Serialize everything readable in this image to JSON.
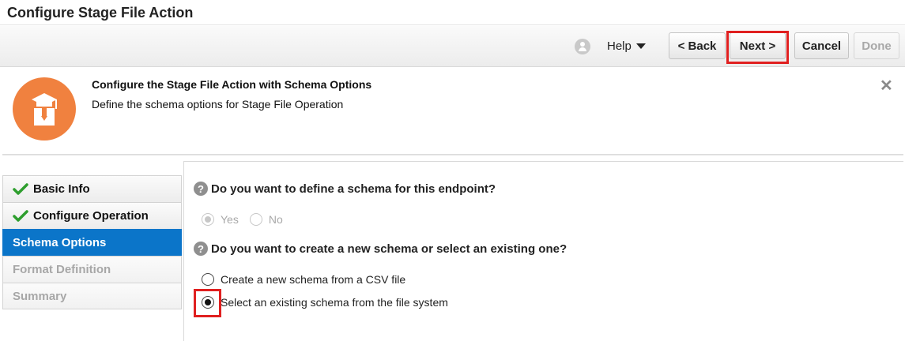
{
  "window": {
    "title": "Configure Stage File Action"
  },
  "toolbar": {
    "help_label": "Help",
    "back_label": "< Back",
    "next_label": "Next >",
    "cancel_label": "Cancel",
    "done_label": "Done"
  },
  "info": {
    "title": "Configure the Stage File Action with Schema Options",
    "subtitle": "Define the schema options for Stage File Operation",
    "close_symbol": "✕"
  },
  "nav": {
    "items": [
      {
        "label": "Basic Info",
        "state": "complete"
      },
      {
        "label": "Configure Operation",
        "state": "complete"
      },
      {
        "label": "Schema Options",
        "state": "active"
      },
      {
        "label": "Format Definition",
        "state": "disabled"
      },
      {
        "label": "Summary",
        "state": "disabled"
      }
    ]
  },
  "content": {
    "q1": {
      "text": "Do you want to define a schema for this endpoint?",
      "options": [
        {
          "label": "Yes",
          "selected": true
        },
        {
          "label": "No",
          "selected": false
        }
      ]
    },
    "q2": {
      "text": "Do you want to create a new schema or select an existing one?",
      "options": [
        {
          "label": "Create a new schema from a CSV file",
          "selected": false
        },
        {
          "label": "Select an existing schema from the file system",
          "selected": true
        }
      ]
    },
    "help_icon_symbol": "?"
  },
  "colors": {
    "accent": "#0b75c9",
    "badge": "#f0813f",
    "highlight": "#e02020",
    "check": "#2e9e2e"
  }
}
